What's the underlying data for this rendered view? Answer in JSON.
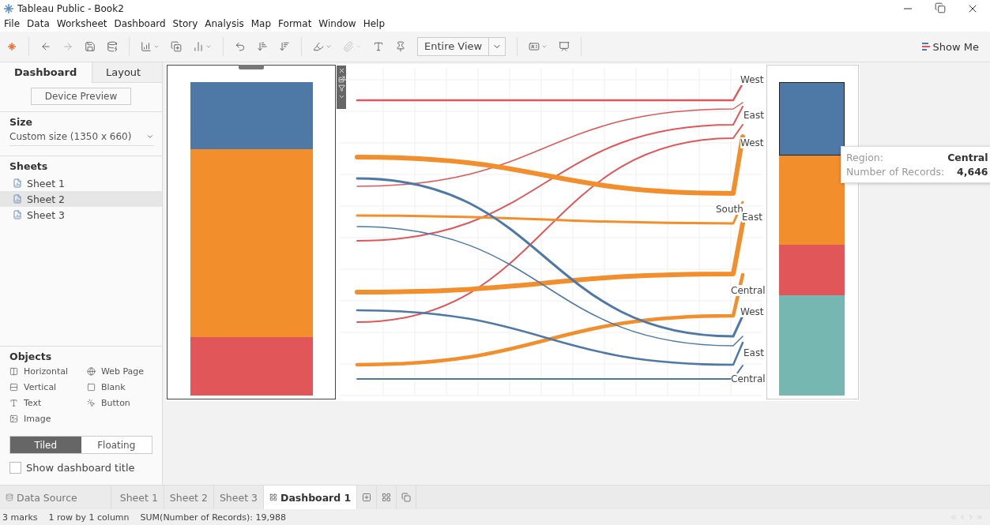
{
  "window": {
    "title": "Tableau Public - Book2"
  },
  "menu": [
    "File",
    "Data",
    "Worksheet",
    "Dashboard",
    "Story",
    "Analysis",
    "Map",
    "Format",
    "Window",
    "Help"
  ],
  "toolbar": {
    "view_mode": "Entire View",
    "show_me": "Show Me"
  },
  "side_panel": {
    "tabs": [
      {
        "label": "Dashboard",
        "selected": true
      },
      {
        "label": "Layout",
        "selected": false
      }
    ],
    "device_preview": "Device Preview",
    "size": {
      "heading": "Size",
      "value": "Custom size (1350 x 660)"
    },
    "sheets": {
      "heading": "Sheets",
      "items": [
        {
          "label": "Sheet 1",
          "selected": false
        },
        {
          "label": "Sheet 2",
          "selected": true
        },
        {
          "label": "Sheet 3",
          "selected": false
        }
      ]
    },
    "objects": {
      "heading": "Objects",
      "items": [
        {
          "label": "Horizontal",
          "kind": "horizontal"
        },
        {
          "label": "Web Page",
          "kind": "web"
        },
        {
          "label": "Vertical",
          "kind": "vertical"
        },
        {
          "label": "Blank",
          "kind": "blank"
        },
        {
          "label": "Text",
          "kind": "text"
        },
        {
          "label": "Button",
          "kind": "button"
        },
        {
          "label": "Image",
          "kind": "image"
        }
      ]
    },
    "placement": [
      {
        "label": "Tiled",
        "selected": true
      },
      {
        "label": "Floating",
        "selected": false
      }
    ],
    "show_title": {
      "label": "Show dashboard title",
      "checked": false
    }
  },
  "dashboard": {
    "left_bar": [
      {
        "color": "#4e79a7"
      },
      {
        "color": "#f28e2b"
      },
      {
        "color": "#e15759"
      }
    ],
    "flow_labels": [
      "West",
      "East",
      "West",
      "South",
      "East",
      "Central",
      "West",
      "East",
      "Central"
    ],
    "right_bar": [
      {
        "color": "#4e79a7",
        "selected": true
      },
      {
        "color": "#f28e2b",
        "selected": false
      },
      {
        "color": "#e15759",
        "selected": false
      },
      {
        "color": "#76b7b2",
        "selected": false
      }
    ],
    "tooltip": [
      {
        "label": "Region:",
        "value": "Central"
      },
      {
        "label": "Number of Records:",
        "value": "4,646"
      }
    ]
  },
  "sheet_tabs": [
    {
      "label": "Data Source",
      "kind": "source",
      "selected": false
    },
    {
      "label": "Sheet 1",
      "kind": "sheet",
      "selected": false
    },
    {
      "label": "Sheet 2",
      "kind": "sheet",
      "selected": false
    },
    {
      "label": "Sheet 3",
      "kind": "sheet",
      "selected": false
    },
    {
      "label": "Dashboard 1",
      "kind": "dashboard",
      "selected": true
    }
  ],
  "status_bar": [
    "3 marks",
    "1 row by 1 column",
    "SUM(Number of Records): 19,988"
  ]
}
